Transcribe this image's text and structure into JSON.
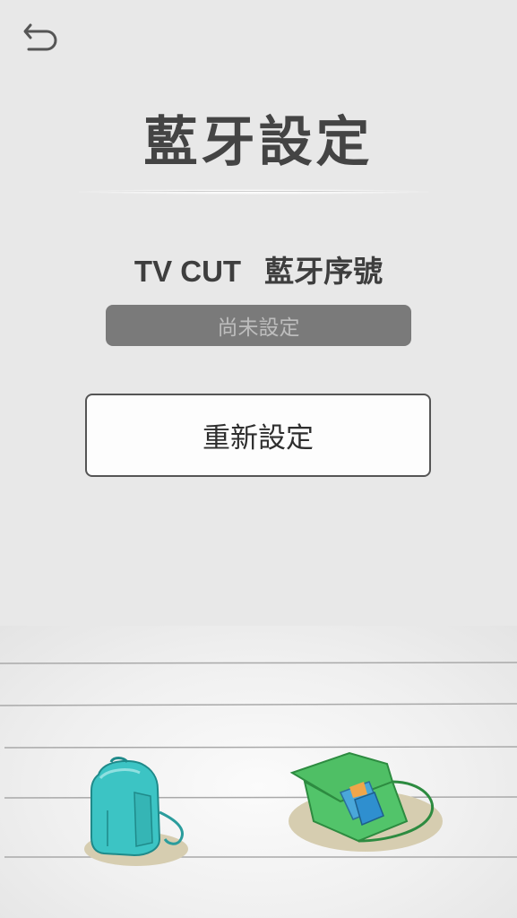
{
  "header": {
    "back_icon": "undo-arrow-icon"
  },
  "page": {
    "title": "藍牙設定"
  },
  "serial": {
    "prefix": "TV CUT",
    "label": "藍牙序號",
    "value": "尚未設定"
  },
  "actions": {
    "reset_label": "重新設定"
  },
  "illustration": {
    "items": [
      "backpack-icon",
      "shoulder-bag-icon"
    ],
    "colors": {
      "backpack": "#3cc4c4",
      "bag": "#4fbf65",
      "shadow": "#d6cdb0"
    }
  }
}
